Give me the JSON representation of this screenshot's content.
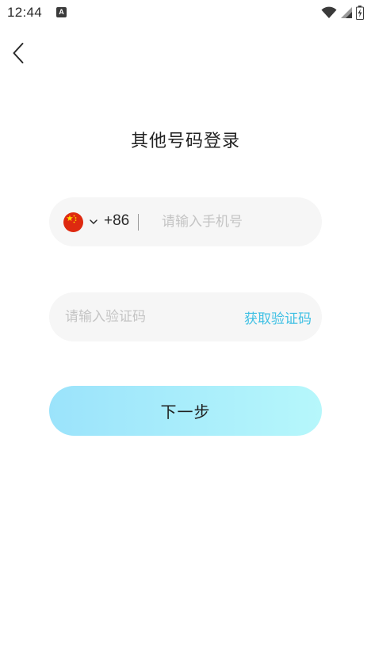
{
  "status_bar": {
    "time": "12:44",
    "notification_icon": "a-icon",
    "notification_glyph": "A",
    "icons": [
      "wifi-icon",
      "signal-icon",
      "battery-icon"
    ]
  },
  "header": {
    "back_icon": "chevron-left-icon",
    "title": "其他号码登录"
  },
  "phone_field": {
    "country_flag": "china-flag-icon",
    "country_code": "+86",
    "placeholder": "请输入手机号",
    "value": ""
  },
  "code_field": {
    "placeholder": "请输入验证码",
    "value": "",
    "get_code_label": "获取验证码"
  },
  "next_button": {
    "label": "下一步"
  },
  "colors": {
    "accent": "#3fc0e4",
    "button_gradient_start": "#9be3fb",
    "button_gradient_end": "#b6f7fb",
    "field_background": "#f6f6f6",
    "placeholder": "#c4c4c4"
  }
}
